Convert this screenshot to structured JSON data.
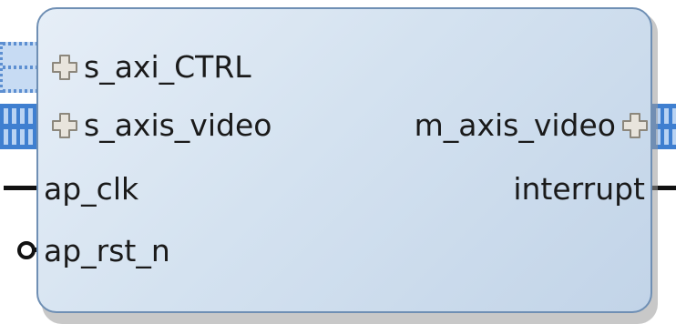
{
  "block": {
    "fill_color": "#d4e2f0",
    "border_color": "#6f8fb4",
    "ports": {
      "s_axi_ctrl": "s_axi_CTRL",
      "s_axis_video": "s_axis_video",
      "m_axis_video": "m_axis_video",
      "ap_clk": "ap_clk",
      "interrupt": "interrupt",
      "ap_rst_n": "ap_rst_n"
    },
    "icons": {
      "expand": "plus-icon",
      "reset_inversion": "inverter-bubble-icon"
    },
    "bus_colors": {
      "axi_lite": "#5d8fd1",
      "axi_stream": "#3f7fd0"
    }
  }
}
